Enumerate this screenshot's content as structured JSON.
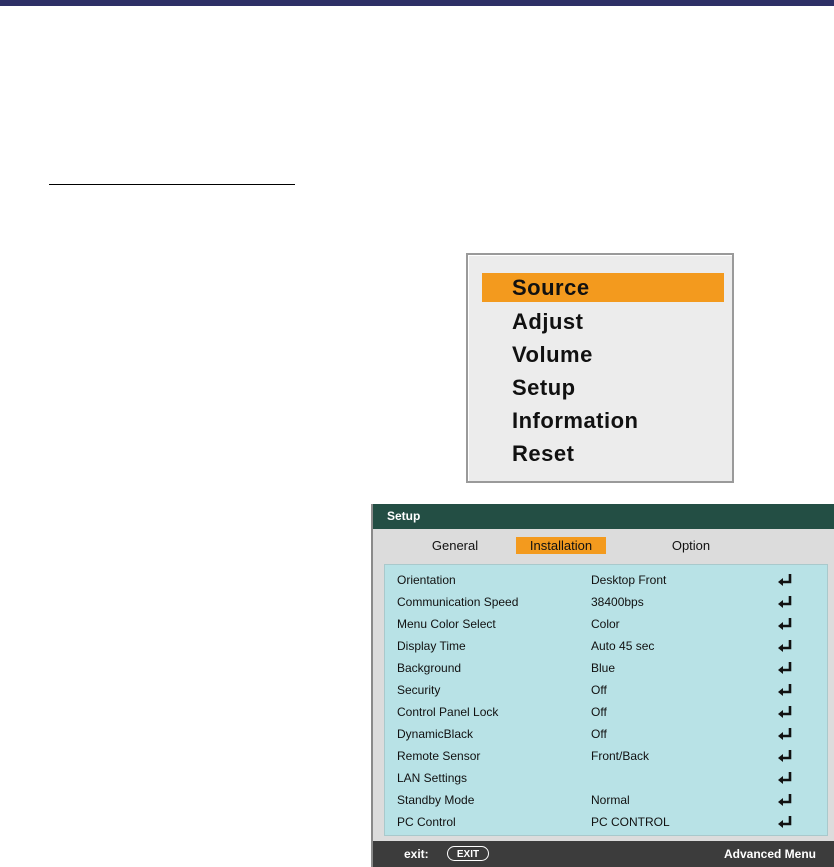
{
  "basic_menu": {
    "items": [
      {
        "label": "Source",
        "selected": true
      },
      {
        "label": "Adjust",
        "selected": false
      },
      {
        "label": "Volume",
        "selected": false
      },
      {
        "label": "Setup",
        "selected": false
      },
      {
        "label": "Information",
        "selected": false
      },
      {
        "label": "Reset",
        "selected": false
      }
    ]
  },
  "advanced_menu": {
    "title": "Setup",
    "tabs": [
      {
        "label": "General",
        "active": false
      },
      {
        "label": "Installation",
        "active": true
      },
      {
        "label": "Option",
        "active": false
      }
    ],
    "rows": [
      {
        "label": "Orientation",
        "value": "Desktop Front"
      },
      {
        "label": "Communication Speed",
        "value": "38400bps"
      },
      {
        "label": "Menu Color Select",
        "value": "Color"
      },
      {
        "label": "Display Time",
        "value": "Auto 45 sec"
      },
      {
        "label": "Background",
        "value": "Blue"
      },
      {
        "label": "Security",
        "value": "Off"
      },
      {
        "label": "Control Panel Lock",
        "value": "Off"
      },
      {
        "label": "DynamicBlack",
        "value": "Off"
      },
      {
        "label": "Remote Sensor",
        "value": "Front/Back"
      },
      {
        "label": "LAN Settings",
        "value": ""
      },
      {
        "label": "Standby Mode",
        "value": "Normal"
      },
      {
        "label": "PC Control",
        "value": "PC CONTROL"
      }
    ],
    "row_icon": "enter-icon",
    "footer": {
      "exit_label": "exit:",
      "exit_key": "EXIT",
      "mode_label": "Advanced Menu"
    }
  },
  "colors": {
    "highlight": "#f39a1e",
    "title_bar": "#234e44",
    "list_background": "#b8e2e6",
    "footer": "#3c3c3c",
    "page_top_bar": "#2e3066"
  }
}
